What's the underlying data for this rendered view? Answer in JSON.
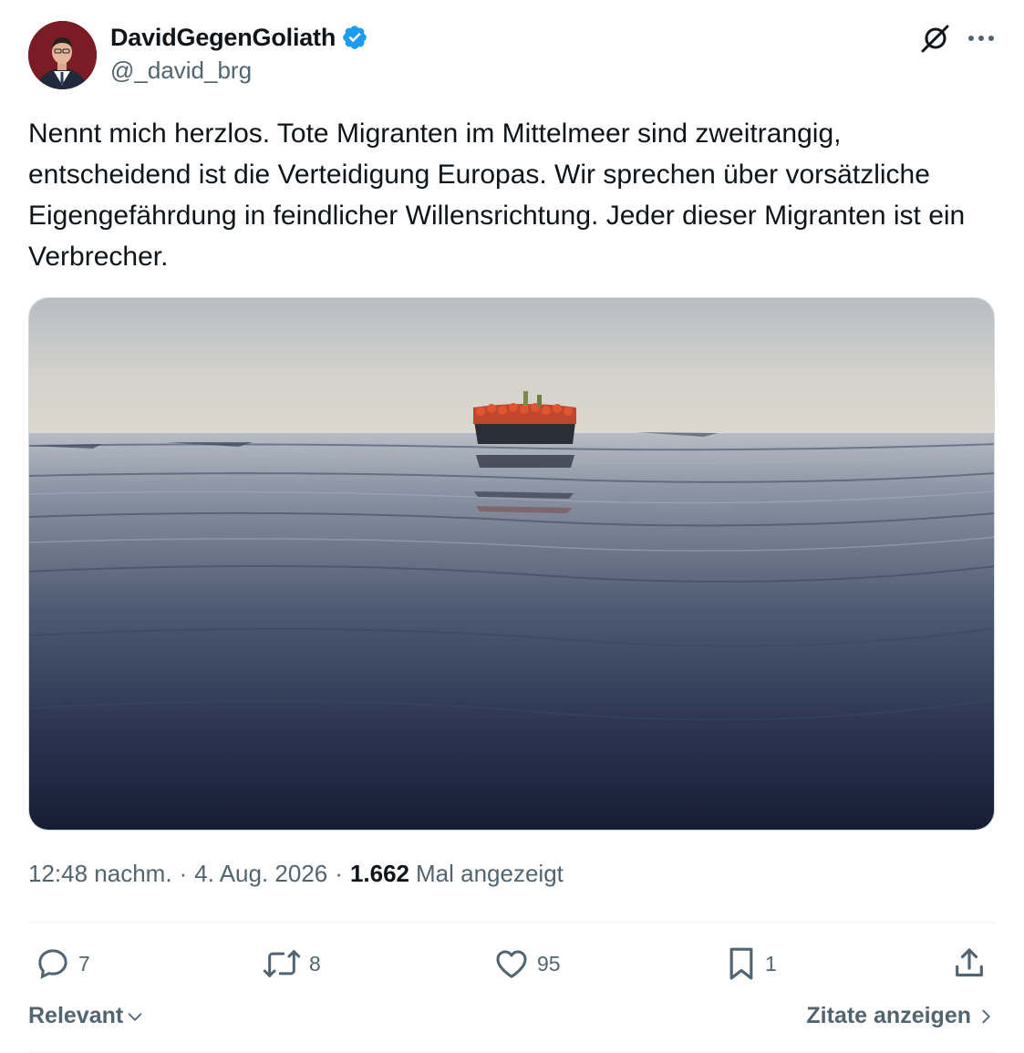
{
  "author": {
    "display_name": "DavidGegenGoliath",
    "handle": "@_david_brg",
    "verified": true
  },
  "tweet": {
    "text": "Nennt mich herzlos. Tote Migranten im Mittelmeer sind zweitrangig, entscheidend ist die Verteidigung Europas. Wir sprechen über vorsätzliche Eigengefährdung in feindlicher Willensrichtung. Jeder dieser Migranten ist ein Verbrecher.",
    "time": "12:48 nachm.",
    "separator": "·",
    "date": "4. Aug. 2026",
    "views_count": "1.662",
    "views_label": "Mal angezeigt"
  },
  "actions": {
    "replies": "7",
    "reposts": "8",
    "likes": "95",
    "bookmarks": "1"
  },
  "footer": {
    "sort_label": "Relevant",
    "quotes_label": "Zitate anzeigen"
  },
  "icons": {
    "verified": "verified-badge-icon",
    "grok": "grok-icon",
    "more": "more-dots-icon",
    "reply": "reply-icon",
    "repost": "repost-icon",
    "like": "heart-icon",
    "bookmark": "bookmark-icon",
    "share": "share-icon"
  },
  "colors": {
    "verified": "#1d9bf0",
    "text_primary": "#0f1419",
    "text_secondary": "#536471",
    "divider": "#eff3f4"
  }
}
